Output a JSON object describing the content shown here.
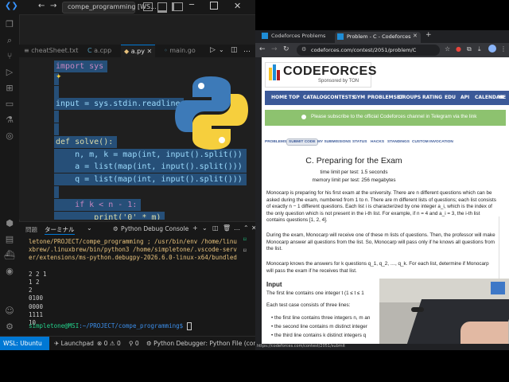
{
  "vscode": {
    "title": "compe_programming [WS...",
    "tabs": [
      "cheatSheet.txt",
      "a.cpp",
      "a.py",
      "main.go"
    ],
    "active_tab": "a.py",
    "code": [
      {
        "text": "import sys",
        "color": "#c586c0"
      },
      {
        "text": "",
        "color": "#d4d4d4"
      },
      {
        "text": "",
        "color": "#d4d4d4"
      },
      {
        "text": "input = sys.stdin.readline",
        "color": "#9cdcfe"
      },
      {
        "text": "",
        "color": "#d4d4d4"
      },
      {
        "text": "",
        "color": "#d4d4d4"
      },
      {
        "text": "def solve():",
        "color": "#dcdcaa"
      },
      {
        "text": "    n, m, k = map(int, input().split())",
        "color": "#9cdcfe"
      },
      {
        "text": "    a = list(map(int, input().split()))",
        "color": "#9cdcfe"
      },
      {
        "text": "    q = list(map(int, input().split()))",
        "color": "#9cdcfe"
      },
      {
        "text": "",
        "color": "#d4d4d4"
      },
      {
        "text": "    if k < n - 1:",
        "color": "#c586c0"
      },
      {
        "text": "        print('0' * m)",
        "color": "#dcdcaa"
      },
      {
        "text": "        return",
        "color": "#c586c0"
      },
      {
        "text": "    else:",
        "color": "#c586c0"
      }
    ],
    "panel_tabs": [
      "問題",
      "ターミナル"
    ],
    "debug_console": "Python Debug Console",
    "terminal_lines": [
      "letone/PROJECT/compe_programming ; /usr/bin/env /home/linu",
      "xbrew/.linuxbrew/bin/python3 /home/simpletone/.vscode-serv",
      "er/extensions/ms-python.debugpy-2026.6.0-linux-x64/bundled",
      "",
      "2 2 1",
      "1 2",
      "2",
      "0100",
      "0000",
      "1111",
      "10"
    ],
    "prompt_user": "simpletone@MSI",
    "prompt_path": ":~/PROJECT/compe_programming$",
    "status": {
      "wsl": "WSL: Ubuntu",
      "launchpad": "Launchpad",
      "errors": "0",
      "warnings": "0",
      "ports": "0",
      "debugger": "Python Debugger: Python File (compe"
    }
  },
  "browser": {
    "tabs": [
      "Codeforces Problems",
      "Problem - C - Codeforces"
    ],
    "url": "codeforces.com/contest/2051/problem/C",
    "status_url": "https://codeforces.com/contest/2051/submit"
  },
  "codeforces": {
    "logo_text": "CODEFORCES",
    "sponsor": "Sponsored by TON",
    "nav": [
      "HOME",
      "TOP",
      "CATALOG",
      "CONTESTS",
      "GYM",
      "PROBLEMSET",
      "GROUPS",
      "RATING",
      "EDU",
      "API",
      "CALENDAR",
      "HE"
    ],
    "telegram_banner": "Please subscribe to the official Codeforces channel in Telegram via the link",
    "subtabs": [
      "PROBLEMS",
      "SUBMIT CODE",
      "MY SUBMISSIONS",
      "STATUS",
      "HACKS",
      "STANDINGS",
      "CUSTOM INVOCATION"
    ],
    "problem_title": "C. Preparing for the Exam",
    "time_limit": "time limit per test: 1.5 seconds",
    "memory_limit": "memory limit per test: 256 megabytes",
    "paragraphs": [
      "Monocarp is preparing for his first exam at the university. There are n different questions which can be asked during the exam, numbered from 1 to n. There are m different lists of questions; each list consists of exactly n − 1 different questions. Each list i is characterized by one integer a_i, which is the index of the only question which is not present in the i-th list. For example, if n = 4 and a_i = 3, the i-th list contains questions [1, 2, 4].",
      "During the exam, Monocarp will receive one of these m lists of questions. Then, the professor will make Monocarp answer all questions from the list. So, Monocarp will pass only if he knows all questions from the list.",
      "Monocarp knows the answers for k questions q_1, q_2, …, q_k. For each list, determine if Monocarp will pass the exam if he receives that list."
    ],
    "input_heading": "Input",
    "input_text": "The first line contains one integer t (1 ≤ t ≤ 1",
    "each_case": "Each test case consists of three lines:",
    "bullets": [
      "the first line contains three integers n, m an",
      "the second line contains m distinct integer",
      "the third line contains k distinct integers q"
    ]
  },
  "colors": {
    "selection": "#264f78",
    "cf_nav": "#3b5998",
    "telegram": "#8dc26f",
    "accent": "#0078d4"
  }
}
